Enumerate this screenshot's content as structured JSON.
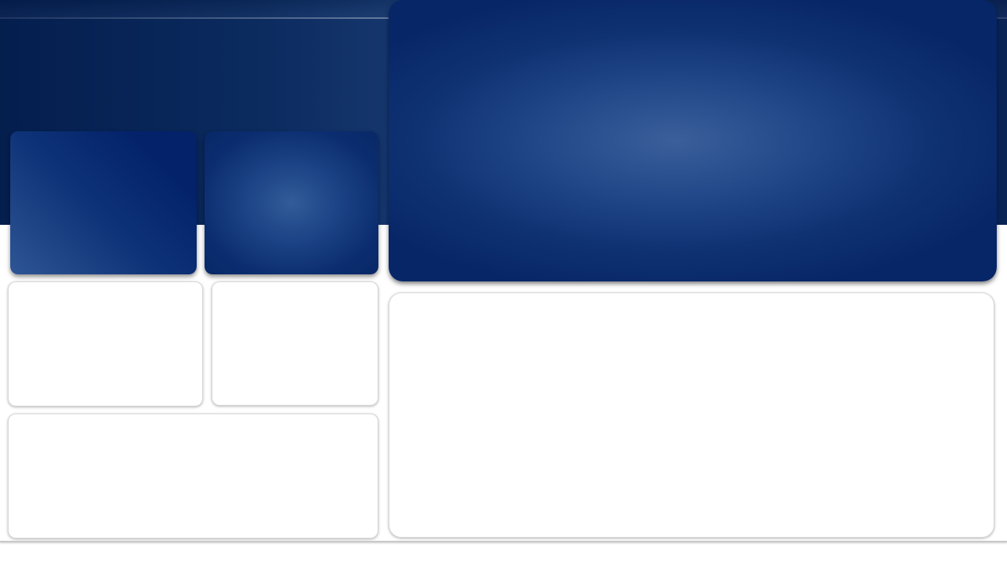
{
  "theme": {
    "hero_color": "#0b2a5e",
    "tile_color": "#03226a",
    "panel_color": "#072667",
    "card_background": "#ffffff",
    "divider_color": "#c8c8c8"
  }
}
